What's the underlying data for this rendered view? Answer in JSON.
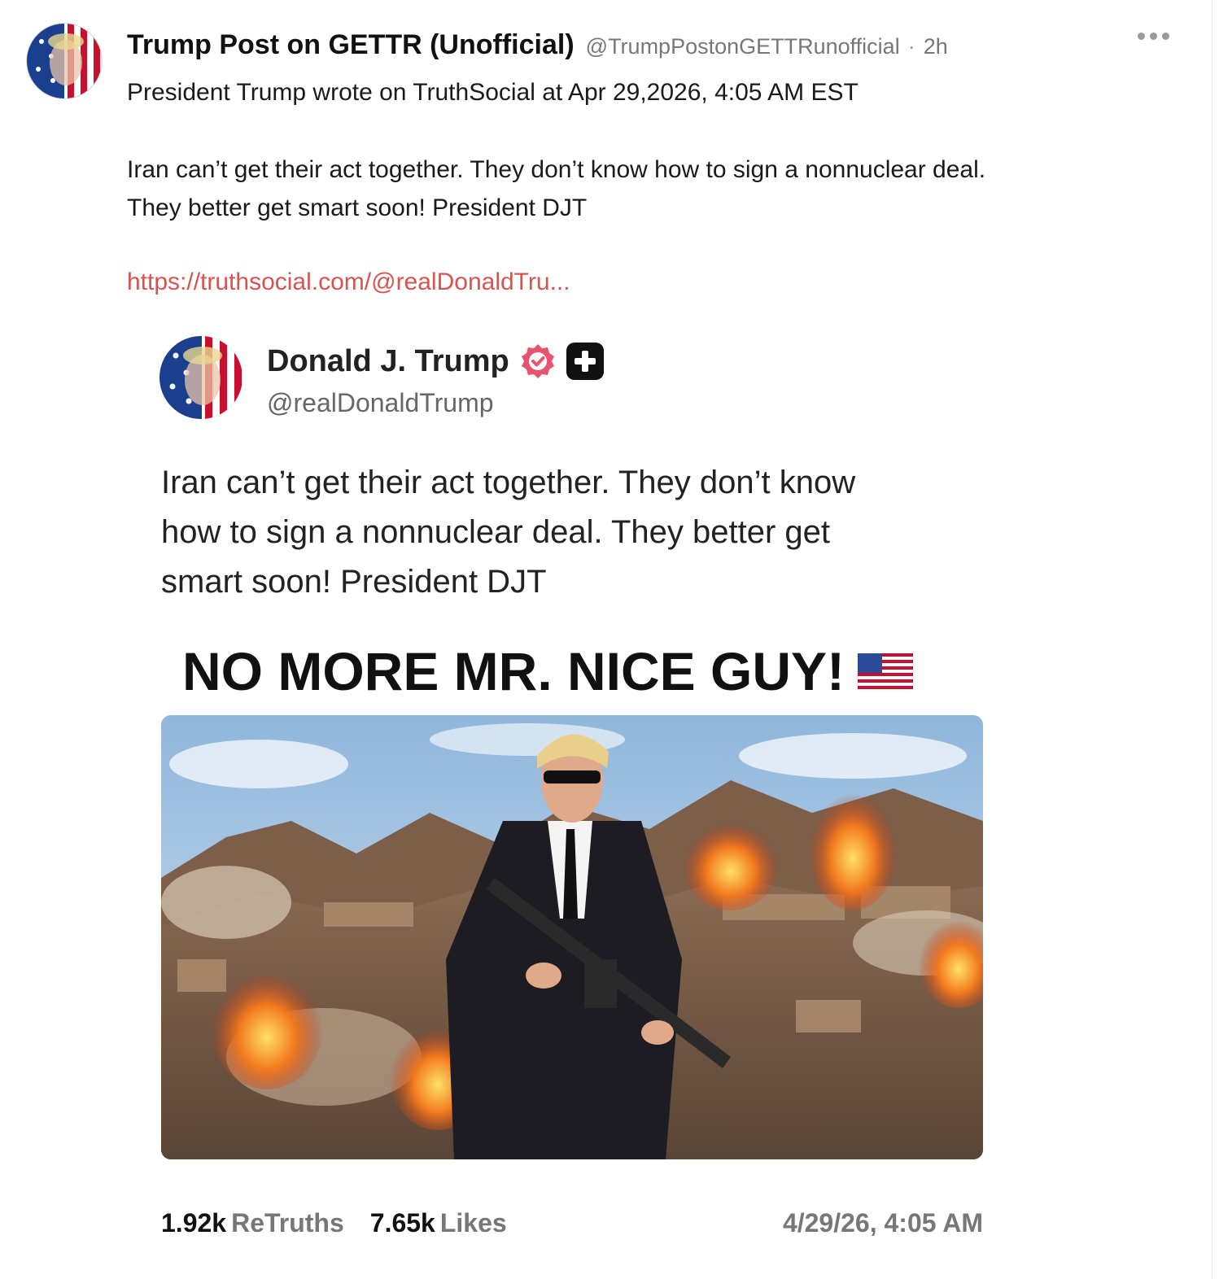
{
  "post": {
    "author_name": "Trump Post on GETTR (Unofficial)",
    "author_handle": "@TrumpPostonGETTRunofficial",
    "separator": "·",
    "age": "2h",
    "line1": "President Trump wrote on TruthSocial at Apr 29,2026, 4:05 AM EST",
    "line2": "Iran can’t get their act together. They don’t know how to sign a nonnuclear deal.",
    "line3": "They better get smart soon! President DJT",
    "link": "https://truthsocial.com/@realDonaldTru..."
  },
  "embed": {
    "name": "Donald J. Trump",
    "handle": "@realDonaldTrump",
    "text_line1": "Iran can’t get their act together. They don’t know",
    "text_line2": "how to sign a nonnuclear deal. They better get",
    "text_line3": "smart soon! President DJT",
    "headline": "NO MORE MR. NICE GUY!",
    "retruths_count": "1.92k",
    "retruths_label": "ReTruths",
    "likes_count": "7.65k",
    "likes_label": "Likes",
    "timestamp": "4/29/26, 4:05 AM"
  },
  "colors": {
    "link": "#d9534f",
    "verified_badge": "#e8536f",
    "muted_text": "#777777"
  },
  "icons": {
    "more": "more-horizontal-icon",
    "verified": "verified-badge-icon",
    "plus": "plus-badge-icon",
    "flag": "us-flag-icon"
  }
}
